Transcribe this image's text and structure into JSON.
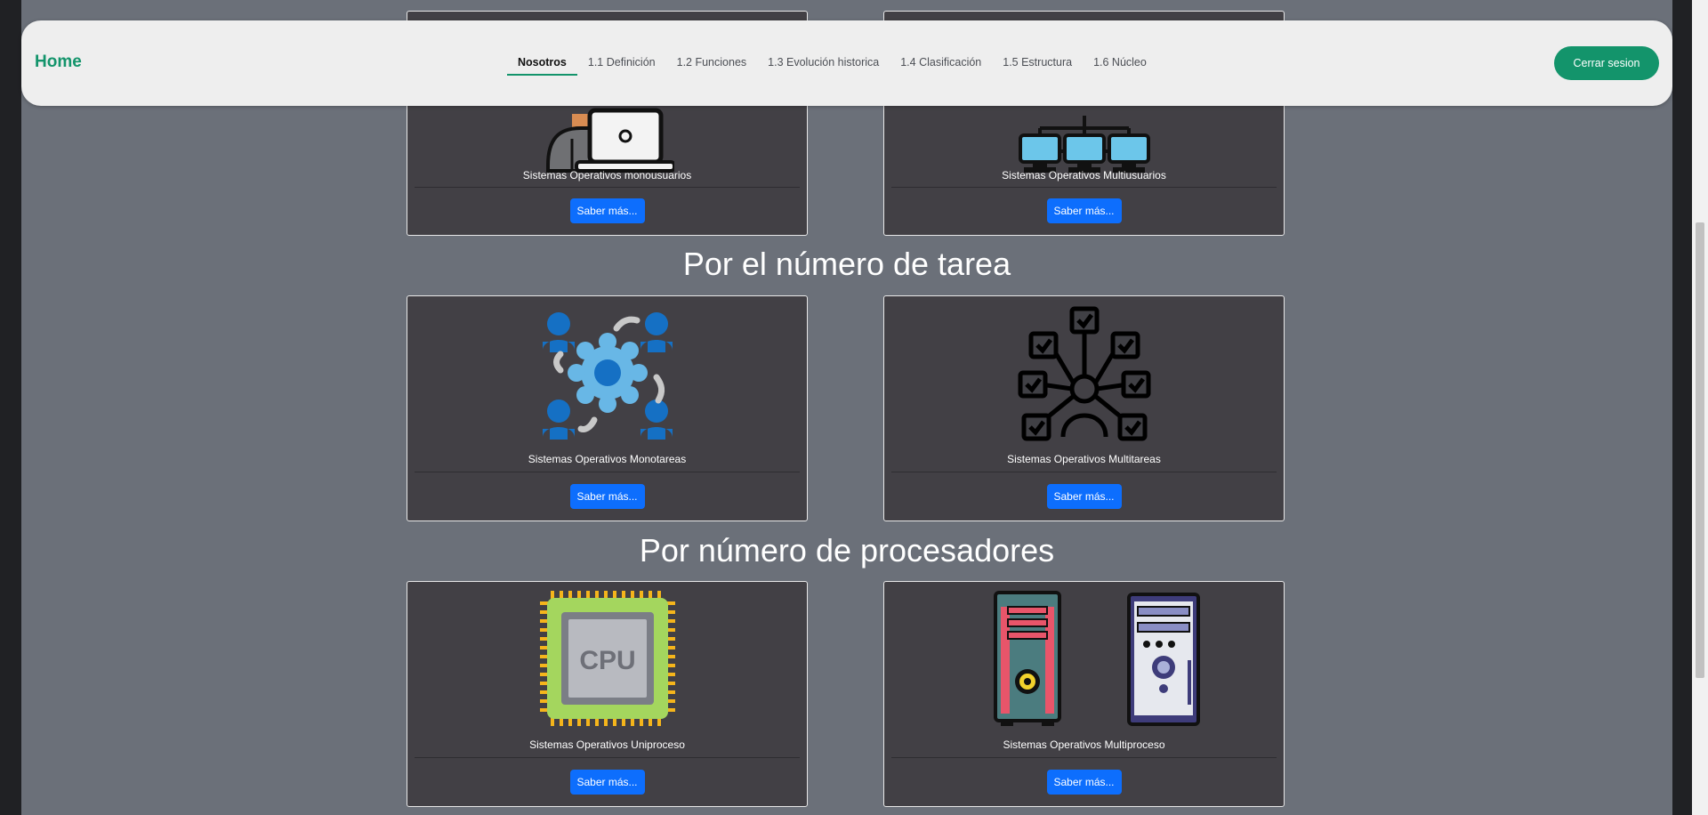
{
  "navbar": {
    "brand": "Home",
    "links": [
      {
        "label": "Nosotros",
        "active": true
      },
      {
        "label": "1.1 Definición",
        "active": false
      },
      {
        "label": "1.2 Funciones",
        "active": false
      },
      {
        "label": "1.3 Evolución historica",
        "active": false
      },
      {
        "label": "1.4 Clasificación",
        "active": false
      },
      {
        "label": "1.5 Estructura",
        "active": false
      },
      {
        "label": "1.6 Núcleo",
        "active": false
      }
    ],
    "logout_label": "Cerrar sesion"
  },
  "sections": [
    {
      "title": "",
      "cards": [
        {
          "title": "Sistemas Operativos monousuarios",
          "button": "Saber más...",
          "icon": "single-user-laptop-icon"
        },
        {
          "title": "Sistemas Operativos Multiusuarios",
          "button": "Saber más...",
          "icon": "networked-computers-icon"
        }
      ]
    },
    {
      "title": "Por el número de tarea",
      "cards": [
        {
          "title": "Sistemas Operativos Monotareas",
          "button": "Saber más...",
          "icon": "users-gear-icon"
        },
        {
          "title": "Sistemas Operativos Multitareas",
          "button": "Saber más...",
          "icon": "multitask-checklist-icon"
        }
      ]
    },
    {
      "title": "Por número de procesadores",
      "cards": [
        {
          "title": "Sistemas Operativos Uniproceso",
          "button": "Saber más...",
          "icon": "cpu-chip-icon",
          "icon_text": "CPU"
        },
        {
          "title": "Sistemas Operativos Multiproceso",
          "button": "Saber más...",
          "icon": "desktop-towers-icon"
        }
      ]
    }
  ],
  "colors": {
    "accent": "#13946b",
    "primary_button": "#0d6efd",
    "card_bg": "#424045",
    "page_bg": "#6b7079"
  }
}
